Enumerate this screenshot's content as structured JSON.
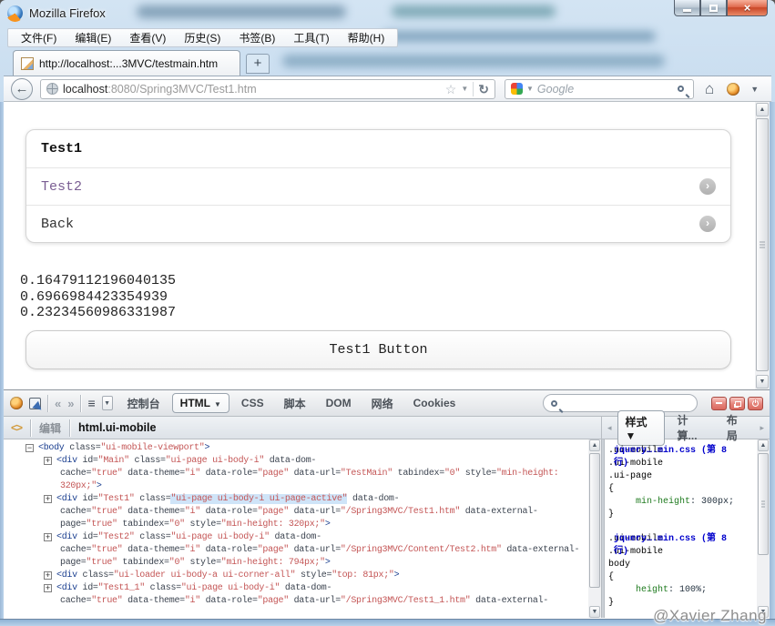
{
  "window": {
    "title": "Mozilla Firefox"
  },
  "menu": {
    "items": [
      "文件(F)",
      "编辑(E)",
      "查看(V)",
      "历史(S)",
      "书签(B)",
      "工具(T)",
      "帮助(H)"
    ]
  },
  "tabs": {
    "active_title": "http://localhost:...3MVC/testmain.htm",
    "new_tab": "+"
  },
  "nav": {
    "url_host": "localhost",
    "url_path": ":8080/Spring3MVC/Test1.htm",
    "search_placeholder": "Google"
  },
  "page": {
    "list_header": "Test1",
    "list_items": [
      "Test2",
      "Back"
    ],
    "numbers": [
      "0.16479112196040135",
      "0.6966984423354939",
      "0.23234560986331987"
    ],
    "button_label": "Test1 Button"
  },
  "firebug": {
    "tabs": [
      {
        "label": "控制台",
        "active": false
      },
      {
        "label": "HTML",
        "active": true,
        "caret": true
      },
      {
        "label": "CSS",
        "active": false
      },
      {
        "label": "脚本",
        "active": false
      },
      {
        "label": "DOM",
        "active": false
      },
      {
        "label": "网络",
        "active": false
      },
      {
        "label": "Cookies",
        "active": false
      }
    ],
    "edit_label": "编辑",
    "breadcrumb": "html.ui-mobile",
    "side_tabs": [
      {
        "label": "样式",
        "active": true,
        "caret": true
      },
      {
        "label": "计算...",
        "active": false
      },
      {
        "label": "布局",
        "active": false
      }
    ],
    "tree_lines": [
      {
        "box": "-",
        "level": 0,
        "seg": [
          [
            "tg",
            "<body"
          ],
          [
            "at",
            " class="
          ],
          [
            "vl",
            "\"ui-mobile-viewport\""
          ],
          [
            "tg",
            ">"
          ]
        ]
      },
      {
        "box": "+",
        "level": 1,
        "seg": [
          [
            "tg",
            "<div"
          ],
          [
            "at",
            " id="
          ],
          [
            "vl",
            "\"Main\""
          ],
          [
            "at",
            " class="
          ],
          [
            "vl",
            "\"ui-page ui-body-i\""
          ],
          [
            "at",
            " data-dom-"
          ]
        ]
      },
      {
        "cont": true,
        "seg": [
          [
            "at",
            "cache="
          ],
          [
            "vl",
            "\"true\""
          ],
          [
            "at",
            " data-theme="
          ],
          [
            "vl",
            "\"i\""
          ],
          [
            "at",
            " data-role="
          ],
          [
            "vl",
            "\"page\""
          ],
          [
            "at",
            " data-url="
          ],
          [
            "vl",
            "\"TestMain\""
          ],
          [
            "at",
            " tabindex="
          ],
          [
            "vl",
            "\"0\""
          ],
          [
            "at",
            " style="
          ],
          [
            "vl",
            "\"min-height:"
          ]
        ]
      },
      {
        "cont": true,
        "seg": [
          [
            "vl",
            "320px;\""
          ],
          [
            "tg",
            ">"
          ]
        ]
      },
      {
        "box": "+",
        "level": 1,
        "seg": [
          [
            "tg",
            "<div"
          ],
          [
            "at",
            " id="
          ],
          [
            "vl",
            "\"Test1\""
          ],
          [
            "at",
            " class="
          ],
          [
            "hl",
            "\"ui-page ui-body-i ui-page-active\""
          ],
          [
            "at",
            " data-dom-"
          ]
        ]
      },
      {
        "cont": true,
        "seg": [
          [
            "at",
            "cache="
          ],
          [
            "vl",
            "\"true\""
          ],
          [
            "at",
            " data-theme="
          ],
          [
            "vl",
            "\"i\""
          ],
          [
            "at",
            " data-role="
          ],
          [
            "vl",
            "\"page\""
          ],
          [
            "at",
            " data-url="
          ],
          [
            "vl",
            "\"/Spring3MVC/Test1.htm\""
          ],
          [
            "at",
            " data-external-"
          ]
        ]
      },
      {
        "cont": true,
        "seg": [
          [
            "at",
            "page="
          ],
          [
            "vl",
            "\"true\""
          ],
          [
            "at",
            " tabindex="
          ],
          [
            "vl",
            "\"0\""
          ],
          [
            "at",
            " style="
          ],
          [
            "vl",
            "\"min-height: 320px;\""
          ],
          [
            "tg",
            ">"
          ]
        ]
      },
      {
        "box": "+",
        "level": 1,
        "seg": [
          [
            "tg",
            "<div"
          ],
          [
            "at",
            " id="
          ],
          [
            "vl",
            "\"Test2\""
          ],
          [
            "at",
            " class="
          ],
          [
            "vl",
            "\"ui-page ui-body-i\""
          ],
          [
            "at",
            " data-dom-"
          ]
        ]
      },
      {
        "cont": true,
        "seg": [
          [
            "at",
            "cache="
          ],
          [
            "vl",
            "\"true\""
          ],
          [
            "at",
            " data-theme="
          ],
          [
            "vl",
            "\"i\""
          ],
          [
            "at",
            " data-role="
          ],
          [
            "vl",
            "\"page\""
          ],
          [
            "at",
            " data-url="
          ],
          [
            "vl",
            "\"/Spring3MVC/Content/Test2.htm\""
          ],
          [
            "at",
            " data-external-"
          ]
        ]
      },
      {
        "cont": true,
        "seg": [
          [
            "at",
            "page="
          ],
          [
            "vl",
            "\"true\""
          ],
          [
            "at",
            " tabindex="
          ],
          [
            "vl",
            "\"0\""
          ],
          [
            "at",
            " style="
          ],
          [
            "vl",
            "\"min-height: 794px;\""
          ],
          [
            "tg",
            ">"
          ]
        ]
      },
      {
        "box": "+",
        "level": 1,
        "seg": [
          [
            "tg",
            "<div"
          ],
          [
            "at",
            " class="
          ],
          [
            "vl",
            "\"ui-loader ui-body-a ui-corner-all\""
          ],
          [
            "at",
            " style="
          ],
          [
            "vl",
            "\"top: 81px;\""
          ],
          [
            "tg",
            ">"
          ]
        ]
      },
      {
        "box": "+",
        "level": 1,
        "seg": [
          [
            "tg",
            "<div"
          ],
          [
            "at",
            " id="
          ],
          [
            "vl",
            "\"Test1_1\""
          ],
          [
            "at",
            " class="
          ],
          [
            "vl",
            "\"ui-page ui-body-i\""
          ],
          [
            "at",
            " data-dom-"
          ]
        ]
      },
      {
        "cont": true,
        "seg": [
          [
            "at",
            "cache="
          ],
          [
            "vl",
            "\"true\""
          ],
          [
            "at",
            " data-theme="
          ],
          [
            "vl",
            "\"i\""
          ],
          [
            "at",
            " data-role="
          ],
          [
            "vl",
            "\"page\""
          ],
          [
            "at",
            " data-url="
          ],
          [
            "vl",
            "\"/Spring3MVC/Test1_1.htm\""
          ],
          [
            "at",
            " data-external-"
          ]
        ]
      }
    ],
    "css_rules": [
      {
        "selector_lines": [
          ".ui-mobile",
          ".ui-mobile",
          ".ui-page"
        ],
        "file_wrap": [
          "jquery….min.css (第 8",
          "行)"
        ],
        "declarations": [
          {
            "property": "min-height",
            "value": "300px"
          }
        ]
      },
      {
        "selector_lines": [
          ".ui-mobile",
          ".ui-mobile",
          "body"
        ],
        "file_wrap": [
          "jquery….min.css (第 8",
          "行)"
        ],
        "declarations": [
          {
            "property": "height",
            "value": "100%"
          }
        ]
      }
    ]
  },
  "watermark": "@Xavier Zhang",
  "colors": {
    "value_red": "#c45656",
    "tag_blue": "#1a3e8f",
    "attr_highlight": "#cfe4f8",
    "css_link_blue": "#0000cc",
    "css_prop_green": "#1e7a1e",
    "visited_purple": "#7a5e93",
    "close_button_red": "#d9553f",
    "glass_blue": "#b4cfe9"
  }
}
